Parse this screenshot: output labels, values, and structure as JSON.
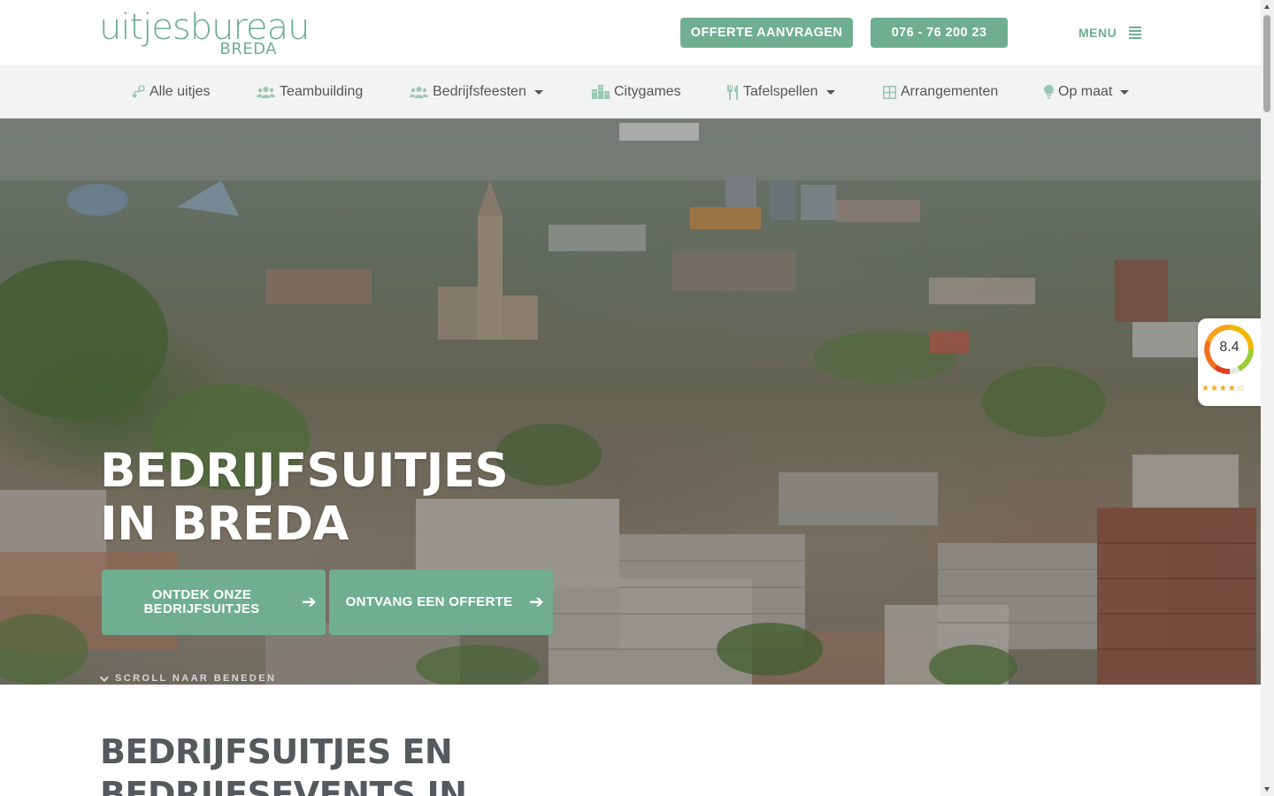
{
  "header": {
    "logo_main": "uitjesbureau",
    "logo_sub": "BREDA",
    "offerte_label": "OFFERTE AANVRAGEN",
    "phone_label": "076 - 76 200 23",
    "menu_label": "MENU"
  },
  "nav": {
    "items": [
      {
        "label": "Alle uitjes",
        "icon": "route-icon",
        "dropdown": false
      },
      {
        "label": "Teambuilding",
        "icon": "users-icon",
        "dropdown": false
      },
      {
        "label": "Bedrijfsfeesten",
        "icon": "users-icon",
        "dropdown": true
      },
      {
        "label": "Citygames",
        "icon": "city-icon",
        "dropdown": false
      },
      {
        "label": "Tafelspellen",
        "icon": "utensils-icon",
        "dropdown": true
      },
      {
        "label": "Arrangementen",
        "icon": "grid-icon",
        "dropdown": false
      },
      {
        "label": "Op maat",
        "icon": "lightbulb-icon",
        "dropdown": true
      }
    ]
  },
  "hero": {
    "title_line1": "BEDRIJFSUITJES",
    "title_line2": "IN BREDA",
    "cta1_label": "ONTDEK ONZE BEDRIJFSUITJES",
    "cta2_label": "ONTVANG EEN OFFERTE",
    "scroll_label": "SCROLL NAAR BENEDEN"
  },
  "rating": {
    "score": "8.4",
    "stars": "★★★★☆"
  },
  "section": {
    "title_line1": "BEDRIJFSUITJES EN",
    "title_line2": "BEDRIJFSEVENTS IN"
  },
  "colors": {
    "accent": "#6fae91",
    "nav_bg": "#f2f3f3",
    "text": "#555555"
  }
}
